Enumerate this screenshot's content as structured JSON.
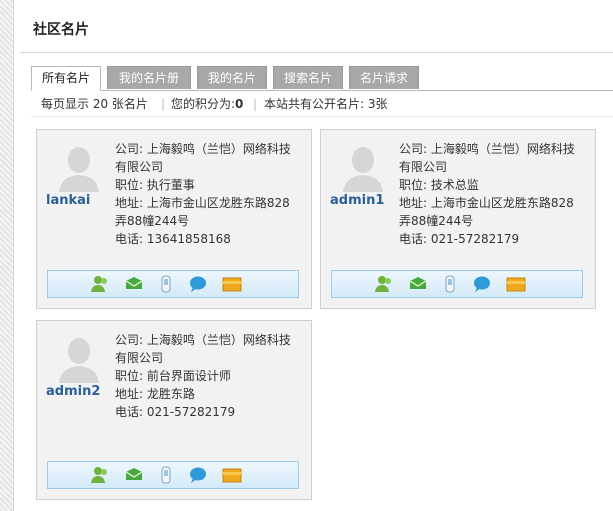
{
  "panel": {
    "title": "社区名片"
  },
  "tabs": [
    {
      "label": "所有名片"
    },
    {
      "label": "我的名片册"
    },
    {
      "label": "我的名片"
    },
    {
      "label": "搜索名片"
    },
    {
      "label": "名片请求"
    }
  ],
  "info": {
    "per_page": "每页显示 20 张名片",
    "points_label": "您的积分为:",
    "points_value": "0",
    "public_cards": "本站共有公开名片: 3张"
  },
  "cards": [
    {
      "user": "lankai",
      "company_label": "公司:",
      "company_1": "上海毅鸣（兰恺）网络科技",
      "company_2": "有限公司",
      "title_label": "职位:",
      "title": "执行董事",
      "address_label": "地址:",
      "address_1": "上海市金山区龙胜东路828",
      "address_2": "弄88幢244号",
      "phone_label": "电话:",
      "phone": "13641858168"
    },
    {
      "user": "admin1",
      "company_label": "公司:",
      "company_1": "上海毅鸣（兰恺）网络科技",
      "company_2": "有限公司",
      "title_label": "职位:",
      "title": "技术总监",
      "address_label": "地址:",
      "address_1": "上海市金山区龙胜东路828",
      "address_2": "弄88幢244号",
      "phone_label": "电话:",
      "phone": "021-57282179"
    },
    {
      "user": "admin2",
      "company_label": "公司:",
      "company_1": "上海毅鸣（兰恺）网络科技",
      "company_2": "有限公司",
      "title_label": "职位:",
      "title": "前台界面设计师",
      "address_label": "地址:",
      "address_1": "龙胜东路",
      "phone_label": "电话:",
      "phone": "021-57282179"
    }
  ],
  "icons": [
    "add-friend-icon",
    "message-icon",
    "mobile-icon",
    "chat-icon",
    "folder-icon"
  ],
  "colors": {
    "username": "#2a5f9a",
    "tab_inactive": "#a8a8a8",
    "action_border": "#9fcbe8"
  }
}
